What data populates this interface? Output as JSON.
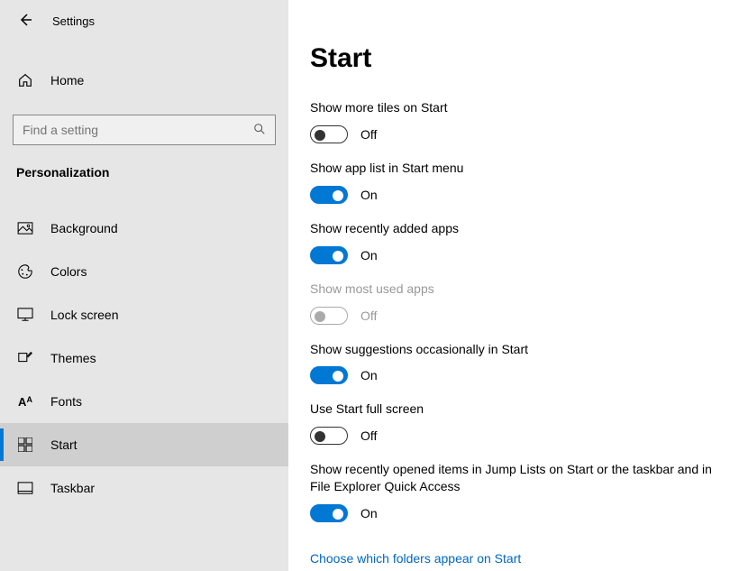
{
  "app_title": "Settings",
  "sidebar": {
    "home_label": "Home",
    "category_label": "Personalization",
    "items": [
      {
        "label": "Background"
      },
      {
        "label": "Colors"
      },
      {
        "label": "Lock screen"
      },
      {
        "label": "Themes"
      },
      {
        "label": "Fonts"
      },
      {
        "label": "Start"
      },
      {
        "label": "Taskbar"
      }
    ]
  },
  "search": {
    "placeholder": "Find a setting"
  },
  "page": {
    "title": "Start",
    "state_on": "On",
    "state_off": "Off",
    "settings": [
      {
        "label": "Show more tiles on Start",
        "value": "off",
        "enabled": true
      },
      {
        "label": "Show app list in Start menu",
        "value": "on",
        "enabled": true
      },
      {
        "label": "Show recently added apps",
        "value": "on",
        "enabled": true
      },
      {
        "label": "Show most used apps",
        "value": "off",
        "enabled": false
      },
      {
        "label": "Show suggestions occasionally in Start",
        "value": "on",
        "enabled": true
      },
      {
        "label": "Use Start full screen",
        "value": "off",
        "enabled": true
      },
      {
        "label": "Show recently opened items in Jump Lists on Start or the taskbar and in File Explorer Quick Access",
        "value": "on",
        "enabled": true
      }
    ],
    "link_label": "Choose which folders appear on Start"
  }
}
